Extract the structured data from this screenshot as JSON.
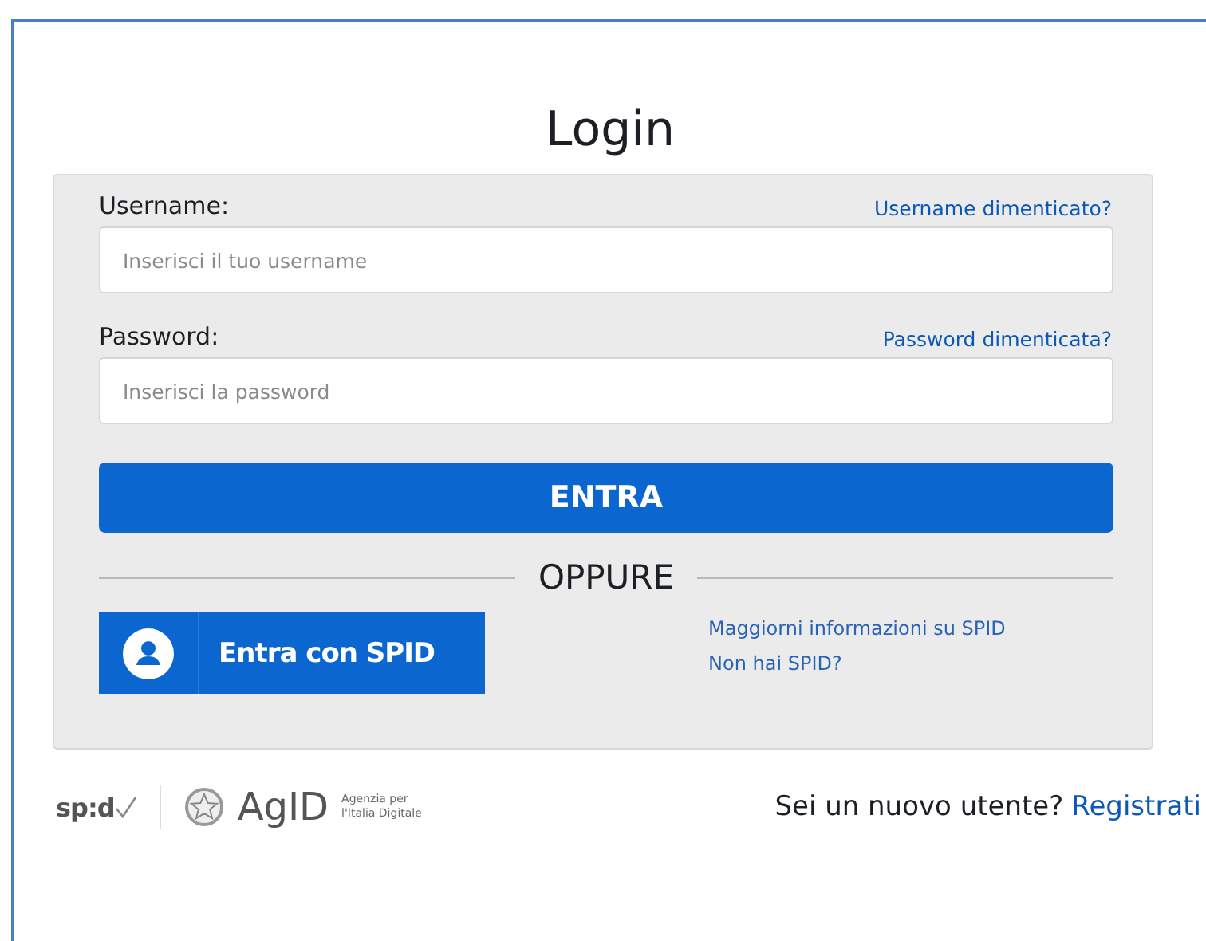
{
  "title": "Login",
  "form": {
    "fields": [
      {
        "label": "Username:",
        "link": "Username dimenticato?",
        "placeholder": "Inserisci il tuo username"
      },
      {
        "label": "Password:",
        "link": "Password dimenticata?",
        "placeholder": "Inserisci la password"
      }
    ],
    "submit": "ENTRA",
    "separator": "OPPURE",
    "spid_button": "Entra con SPID",
    "spid_links": [
      "Maggiorni informazioni su SPID",
      "Non hai SPID?"
    ]
  },
  "footer": {
    "spid_logo": "sp:d",
    "agid_logo": "AgID",
    "agid_tagline": [
      "Agenzia per",
      "l'Italia Digitale"
    ],
    "register_prompt": "Sei un nuovo utente?",
    "register_link": "Registrati"
  }
}
